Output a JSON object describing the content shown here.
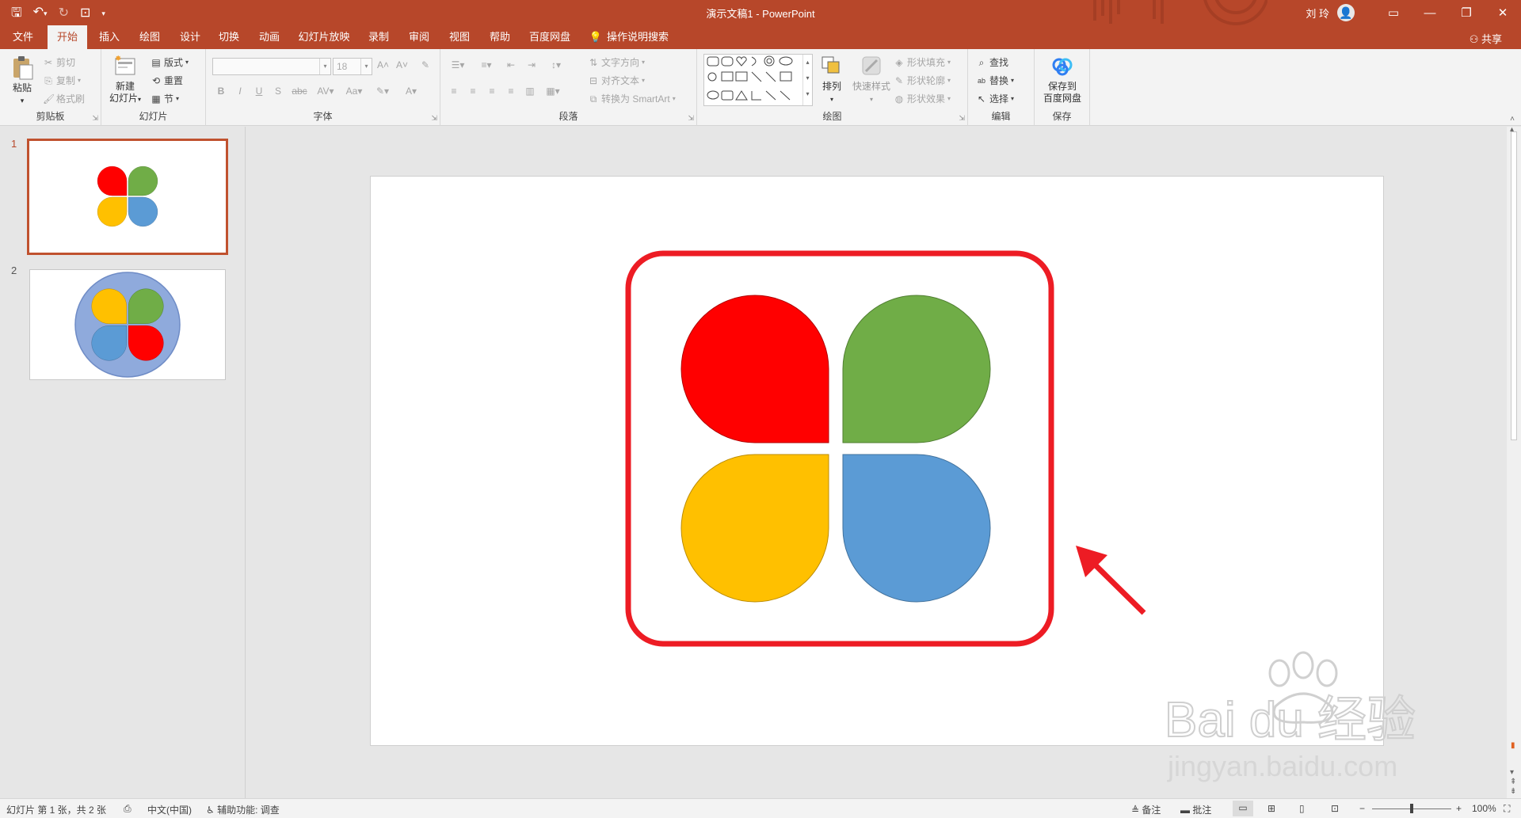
{
  "window": {
    "title": "演示文稿1 - PowerPoint",
    "user": "刘 玲",
    "minimize": "—",
    "ribbon_display": "▭",
    "maximize": "❐",
    "close": "✕"
  },
  "tabs": [
    {
      "label": "文件",
      "active": false
    },
    {
      "label": "开始",
      "active": true
    },
    {
      "label": "插入",
      "active": false
    },
    {
      "label": "绘图",
      "active": false
    },
    {
      "label": "设计",
      "active": false
    },
    {
      "label": "切换",
      "active": false
    },
    {
      "label": "动画",
      "active": false
    },
    {
      "label": "幻灯片放映",
      "active": false
    },
    {
      "label": "录制",
      "active": false
    },
    {
      "label": "审阅",
      "active": false
    },
    {
      "label": "视图",
      "active": false
    },
    {
      "label": "帮助",
      "active": false
    },
    {
      "label": "百度网盘",
      "active": false
    }
  ],
  "tell_me": "操作说明搜索",
  "share": "共享",
  "ribbon": {
    "clipboard": {
      "label": "剪贴板",
      "paste": "粘贴",
      "cut": "剪切",
      "copy": "复制",
      "format_painter": "格式刷"
    },
    "slides": {
      "label": "幻灯片",
      "new_slide_1": "新建",
      "new_slide_2": "幻灯片",
      "layout": "版式",
      "reset": "重置",
      "section": "节"
    },
    "font": {
      "label": "字体",
      "font_name": "",
      "font_size": "18"
    },
    "paragraph": {
      "label": "段落",
      "text_direction": "文字方向",
      "align_text": "对齐文本",
      "smartart": "转换为 SmartArt"
    },
    "drawing": {
      "label": "绘图",
      "arrange": "排列",
      "quick_styles": "快速样式",
      "shape_fill": "形状填充",
      "shape_outline": "形状轮廓",
      "shape_effects": "形状效果"
    },
    "editing": {
      "label": "编辑",
      "find": "查找",
      "replace": "替换",
      "select": "选择"
    },
    "save": {
      "label": "保存",
      "save_to_1": "保存到",
      "save_to_2": "百度网盘"
    }
  },
  "slides": [
    {
      "number": "1",
      "active": true
    },
    {
      "number": "2",
      "active": false
    }
  ],
  "status": {
    "slide_info": "幻灯片 第 1 张，共 2 张",
    "language": "中文(中国)",
    "accessibility": "辅助功能: 调查",
    "notes": "备注",
    "comments": "批注",
    "zoom": "100%",
    "zoom_minus": "−",
    "zoom_plus": "+"
  },
  "colors": {
    "brand": "#b7472a",
    "petal_red": "#ff0000",
    "petal_green": "#70ad47",
    "petal_yellow": "#ffc000",
    "petal_blue": "#5b9bd5",
    "highlight": "#ed1c24",
    "circle_bg": "#8faadc"
  },
  "watermark": {
    "line1": "Bai du 经验",
    "line2": "jingyan.baidu.com"
  }
}
